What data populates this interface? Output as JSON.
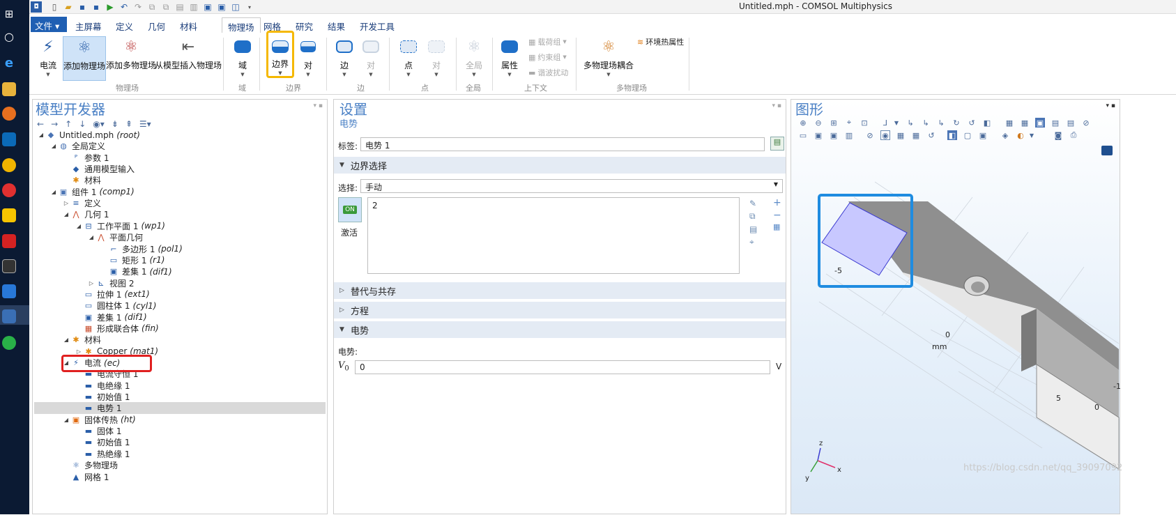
{
  "window": {
    "title": "Untitled.mph - COMSOL Multiphysics"
  },
  "menu": {
    "file": "文件",
    "tabs": [
      "主屏幕",
      "定义",
      "几何",
      "材料",
      "物理场",
      "网格",
      "研究",
      "结果",
      "开发工具"
    ]
  },
  "ribbon": {
    "buttons": {
      "current": "电流",
      "add_physics": "添加物理场",
      "add_multiphysics": "添加多物理场",
      "insert_from_model": "从模型插入物理场",
      "domain": "域",
      "boundary": "边界",
      "pair": "对",
      "edge": "边",
      "edge_pair": "对",
      "point": "点",
      "point_pair": "对",
      "global": "全局",
      "properties": "属性",
      "multiphysics_coupling": "多物理场耦合"
    },
    "small": {
      "load_group": "载荷组",
      "constraint_group": "约束组",
      "harmonic_perturbation": "谐波扰动",
      "ambient_thermal": "环境热属性"
    },
    "groups": {
      "physics": "物理场",
      "domain": "域",
      "boundary": "边界",
      "edge": "边",
      "point": "点",
      "global": "全局",
      "context": "上下文",
      "multiphysics": "多物理场"
    },
    "highlight_color": "#f5b800"
  },
  "model_builder": {
    "title": "模型开发器",
    "tree": [
      {
        "label": "Untitled.mph",
        "tag": "(root)",
        "icon": "model-icon"
      },
      {
        "label": "全局定义",
        "tag": "",
        "icon": "globe-icon"
      },
      {
        "label": "参数 1",
        "tag": "",
        "icon": "parameters-icon"
      },
      {
        "label": "通用模型输入",
        "tag": "",
        "icon": "model-input-icon"
      },
      {
        "label": "材料",
        "tag": "",
        "icon": "material-icon"
      },
      {
        "label": "组件 1",
        "tag": "(comp1)",
        "icon": "component-icon"
      },
      {
        "label": "定义",
        "tag": "",
        "icon": "definitions-icon"
      },
      {
        "label": "几何 1",
        "tag": "",
        "icon": "geometry-icon"
      },
      {
        "label": "工作平面 1",
        "tag": "(wp1)",
        "icon": "work-plane-icon"
      },
      {
        "label": "平面几何",
        "tag": "",
        "icon": "plane-geometry-icon"
      },
      {
        "label": "多边形 1",
        "tag": "(pol1)",
        "icon": "polygon-icon"
      },
      {
        "label": "矩形 1",
        "tag": "(r1)",
        "icon": "rectangle-icon"
      },
      {
        "label": "差集 1",
        "tag": "(dif1)",
        "icon": "difference-icon"
      },
      {
        "label": "视图 2",
        "tag": "",
        "icon": "view-icon"
      },
      {
        "label": "拉伸 1",
        "tag": "(ext1)",
        "icon": "extrude-icon"
      },
      {
        "label": "圆柱体 1",
        "tag": "(cyl1)",
        "icon": "cylinder-icon"
      },
      {
        "label": "差集 1",
        "tag": "(dif1)",
        "icon": "difference-icon"
      },
      {
        "label": "形成联合体",
        "tag": "(fin)",
        "icon": "form-union-icon"
      },
      {
        "label": "材料",
        "tag": "",
        "icon": "material-icon"
      },
      {
        "label": "Copper",
        "tag": "(mat1)",
        "icon": "material-icon"
      },
      {
        "label": "电流",
        "tag": "(ec)",
        "icon": "current-icon"
      },
      {
        "label": "电流守恒 1",
        "tag": "",
        "icon": "current-conservation-icon"
      },
      {
        "label": "电绝缘 1",
        "tag": "",
        "icon": "electric-insulation-icon"
      },
      {
        "label": "初始值 1",
        "tag": "",
        "icon": "initial-values-icon"
      },
      {
        "label": "电势 1",
        "tag": "",
        "icon": "electric-potential-icon"
      },
      {
        "label": "固体传热",
        "tag": "(ht)",
        "icon": "heat-transfer-icon"
      },
      {
        "label": "固体 1",
        "tag": "",
        "icon": "solid-icon"
      },
      {
        "label": "初始值 1",
        "tag": "",
        "icon": "initial-values-icon"
      },
      {
        "label": "热绝缘 1",
        "tag": "",
        "icon": "thermal-insulation-icon"
      },
      {
        "label": "多物理场",
        "tag": "",
        "icon": "multiphysics-icon"
      },
      {
        "label": "网格 1",
        "tag": "",
        "icon": "mesh-icon"
      }
    ]
  },
  "settings": {
    "title": "设置",
    "subtitle": "电势",
    "label_caption": "标签:",
    "label_value": "电势 1",
    "section_boundary": "边界选择",
    "selection_caption": "选择:",
    "selection_value": "手动",
    "active_label": "激活",
    "toggle_text": "ON",
    "selection_list": [
      "2"
    ],
    "section_override": "替代与共存",
    "section_equation": "方程",
    "section_potential": "电势",
    "potential_caption": "电势:",
    "var_symbol": "V",
    "var_subscript": "0",
    "var_value": "0",
    "var_unit": "V"
  },
  "graphics": {
    "title": "图形",
    "axis_labels": {
      "n5": "-5",
      "zero_a": "0",
      "mm": "mm",
      "five": "5",
      "zero_b": "0",
      "neg": "-1"
    },
    "triad": {
      "x": "x",
      "y": "y",
      "z": "z"
    },
    "selection_color": "#c8c8ff",
    "highlight_color": "#1f8ce0"
  },
  "watermark": "https://blog.csdn.net/qq_39097092"
}
